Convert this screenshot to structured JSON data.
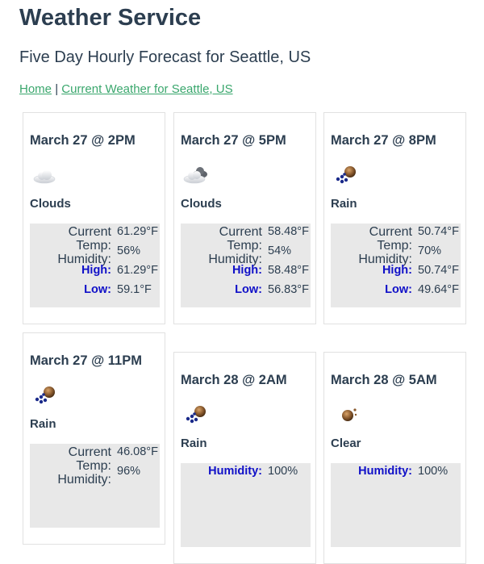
{
  "header": {
    "title": "Weather Service",
    "subtitle": "Five Day Hourly Forecast for Seattle, US"
  },
  "nav": {
    "home": "Home",
    "separator": "|",
    "current": "Current Weather for Seattle, US"
  },
  "labels": {
    "current": "Current",
    "temp": "Temp:",
    "humidity": "Humidity:",
    "high": "High:",
    "low": "Low:"
  },
  "forecasts": [
    {
      "time": "March 27 @ 2PM",
      "icon": "clouds-icon",
      "condition": "Clouds",
      "current_temp": "61.29°F",
      "humidity": "56%",
      "high": "61.29°F",
      "low": "59.1°F"
    },
    {
      "time": "March 27 @ 5PM",
      "icon": "clouds-icon",
      "condition": "Clouds",
      "current_temp": "58.48°F",
      "humidity": "54%",
      "high": "58.48°F",
      "low": "56.83°F"
    },
    {
      "time": "March 27 @ 8PM",
      "icon": "rain-icon",
      "condition": "Rain",
      "current_temp": "50.74°F",
      "humidity": "70%",
      "high": "50.74°F",
      "low": "49.64°F"
    },
    {
      "time": "March 27 @ 11PM",
      "icon": "rain-icon",
      "condition": "Rain",
      "current_temp": "46.08°F",
      "humidity": "96%"
    },
    {
      "time": "March 28 @ 2AM",
      "icon": "rain-icon",
      "condition": "Rain",
      "humidity": "100%"
    },
    {
      "time": "March 28 @ 5AM",
      "icon": "clear-icon",
      "condition": "Clear",
      "humidity": "100%"
    }
  ]
}
